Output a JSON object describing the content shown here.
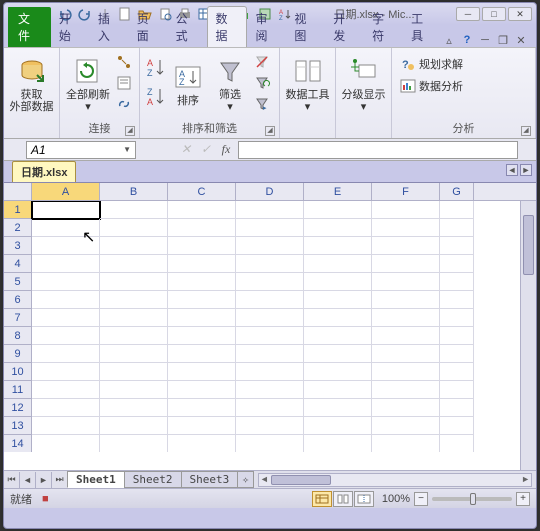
{
  "window": {
    "title": "日期.xlsx - Mic...",
    "app_icon_text": "X"
  },
  "qat": {
    "save": "save-icon",
    "undo": "undo-icon",
    "redo": "redo-icon"
  },
  "ribbon_tabs": {
    "file": "文件",
    "home": "开始",
    "insert": "插入",
    "page": "页面",
    "formula": "公式",
    "data": "数据",
    "review": "审阅",
    "view": "视图",
    "dev": "开发",
    "char": "字符",
    "tools": "工具"
  },
  "ribbon_groups": {
    "external": {
      "btn": "获取\n外部数据",
      "label": ""
    },
    "connections": {
      "refresh": "全部刷新",
      "label": "连接"
    },
    "sort_filter": {
      "sort": "排序",
      "filter": "筛选",
      "label": "排序和筛选"
    },
    "data_tools": {
      "btn": "数据工具",
      "label": ""
    },
    "outline": {
      "btn": "分级显示",
      "label": ""
    },
    "analysis": {
      "solver": "规划求解",
      "analysis": "数据分析",
      "label": "分析"
    }
  },
  "namebox": {
    "value": "A1"
  },
  "fx": {
    "label": "fx",
    "value": ""
  },
  "workbook_tab": "日期.xlsx",
  "columns": [
    "A",
    "B",
    "C",
    "D",
    "E",
    "F",
    "G"
  ],
  "rows": [
    1,
    2,
    3,
    4,
    5,
    6,
    7,
    8,
    9,
    10,
    11,
    12,
    13,
    14
  ],
  "active_cell": "A1",
  "sheets": [
    "Sheet1",
    "Sheet2",
    "Sheet3"
  ],
  "active_sheet": 0,
  "status": {
    "ready": "就绪",
    "rec": "■",
    "zoom": "100%"
  }
}
